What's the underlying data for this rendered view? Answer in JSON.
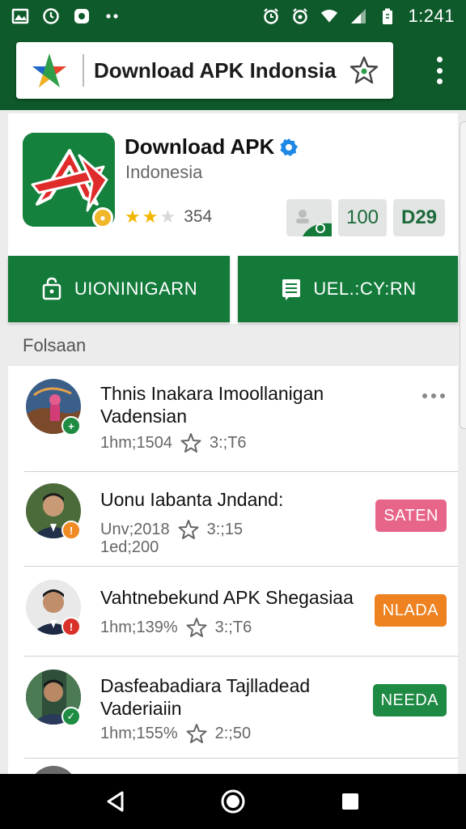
{
  "status_bar": {
    "time": "1:241",
    "icons": [
      "gallery-icon",
      "clock-icon",
      "settings-icon",
      "more-notifications-icon",
      "alarm-icon",
      "alarm-icon",
      "wifi-icon",
      "signal-icon",
      "battery-icon"
    ]
  },
  "app_bar": {
    "title": "Download APK Indonsia",
    "logo_icon": "apk-logo-icon",
    "favorite_icon": "star-outline-icon",
    "menu_icon": "overflow-menu-icon"
  },
  "app_header": {
    "name": "Download APK",
    "developer": "Indonesia",
    "rating_stars": 2,
    "rating_max": 3,
    "rating_count": "354",
    "stat_100": "100",
    "stat_d29": "D29",
    "install_button": "UIONINIGARN",
    "second_button": "UEL.:CY:RN"
  },
  "section_label": "Folsaan",
  "list": [
    {
      "title_line1": "Thnis Inakara  Imoollanigan",
      "title_line2": "Vadensian",
      "meta": "1hm;1504",
      "rating": "3:;T6",
      "tag": "",
      "badge_color": "#1e8c42"
    },
    {
      "title_line1": "Uonu Iabanta Jndand:",
      "title_line2": "",
      "meta": "Unv;2018",
      "meta2": "1ed;200",
      "rating": "3:;15",
      "tag": "SATEN",
      "tag_color": "#e8658a",
      "badge_color": "#f08a24"
    },
    {
      "title_line1": "Vahtnebekund APK Shegasiaa",
      "title_line2": "",
      "meta": "1hm;139%",
      "rating": "3:;T6",
      "tag": "NLADA",
      "tag_color": "#ee8120",
      "badge_color": "#d9302a"
    },
    {
      "title_line1": "Dasfeabadiara Tajlladead",
      "title_line2": "Vaderiaiin",
      "meta": "1hm;155%",
      "rating": "2:;50",
      "tag": "NEEDA",
      "tag_color": "#1e8a44",
      "badge_color": "#1e8c42"
    }
  ],
  "nav_bar": {
    "icons": [
      "back-icon",
      "home-icon",
      "recents-icon"
    ]
  },
  "colors": {
    "primary": "#0f5a2b",
    "button": "#137a3a",
    "star": "#f2b500"
  }
}
